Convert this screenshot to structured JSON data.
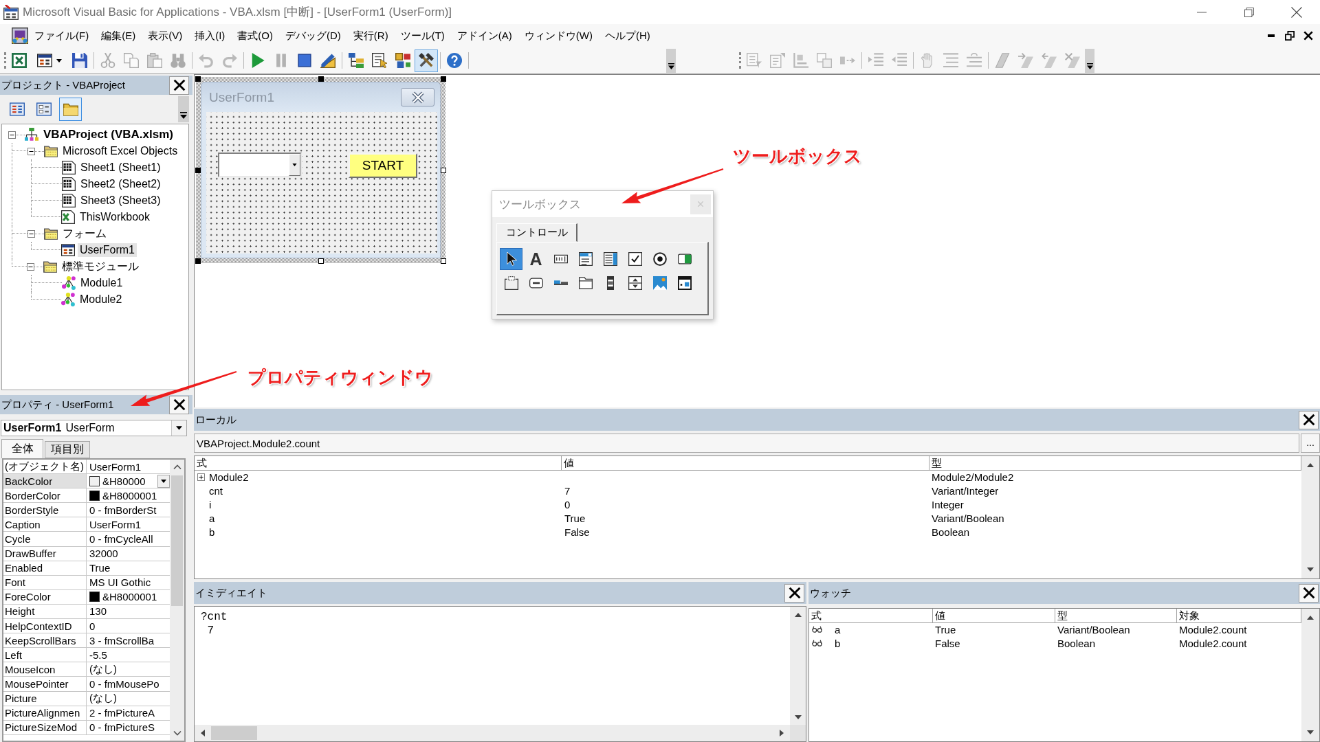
{
  "window": {
    "title": "Microsoft Visual Basic for Applications - VBA.xlsm [中断] - [UserForm1 (UserForm)]"
  },
  "menu": [
    "ファイル(F)",
    "編集(E)",
    "表示(V)",
    "挿入(I)",
    "書式(O)",
    "デバッグ(D)",
    "実行(R)",
    "ツール(T)",
    "アドイン(A)",
    "ウィンドウ(W)",
    "ヘルプ(H)"
  ],
  "toolbars": [
    {
      "kind": "standard",
      "items": [
        {
          "kind": "excel",
          "disabled": false,
          "pressed": false
        },
        {
          "kind": "insert-form",
          "disabled": false,
          "pressed": false
        },
        {
          "kind": "save",
          "disabled": false,
          "pressed": false
        },
        {
          "kind": "separator"
        },
        {
          "kind": "cut",
          "disabled": true,
          "pressed": false
        },
        {
          "kind": "copy",
          "disabled": true,
          "pressed": false
        },
        {
          "kind": "paste",
          "disabled": true,
          "pressed": false
        },
        {
          "kind": "find",
          "disabled": true,
          "pressed": false
        },
        {
          "kind": "separator"
        },
        {
          "kind": "undo",
          "disabled": true,
          "pressed": false
        },
        {
          "kind": "redo",
          "disabled": true,
          "pressed": false
        },
        {
          "kind": "separator"
        },
        {
          "kind": "run",
          "disabled": false,
          "pressed": false
        },
        {
          "kind": "break",
          "disabled": true,
          "pressed": false
        },
        {
          "kind": "reset",
          "disabled": false,
          "pressed": false
        },
        {
          "kind": "design-mode",
          "disabled": false,
          "pressed": false
        },
        {
          "kind": "separator"
        },
        {
          "kind": "project-explorer",
          "disabled": false,
          "pressed": false
        },
        {
          "kind": "properties",
          "disabled": false,
          "pressed": false
        },
        {
          "kind": "object-browser",
          "disabled": false,
          "pressed": false
        },
        {
          "kind": "toolbox",
          "disabled": false,
          "pressed": true
        },
        {
          "kind": "separator"
        },
        {
          "kind": "help",
          "disabled": false,
          "pressed": false
        },
        {
          "kind": "separator"
        }
      ]
    },
    {
      "kind": "edit",
      "items": [
        {
          "kind": "list-properties",
          "disabled": true,
          "pressed": false
        },
        {
          "kind": "list-constants",
          "disabled": true,
          "pressed": false
        },
        {
          "kind": "quick-info",
          "disabled": true,
          "pressed": false
        },
        {
          "kind": "parameter-info",
          "disabled": true,
          "pressed": false
        },
        {
          "kind": "complete-word",
          "disabled": true,
          "pressed": false
        },
        {
          "kind": "separator"
        },
        {
          "kind": "indent",
          "disabled": true,
          "pressed": false
        },
        {
          "kind": "outdent",
          "disabled": true,
          "pressed": false
        },
        {
          "kind": "separator"
        },
        {
          "kind": "toggle-breakpoint",
          "disabled": true,
          "pressed": false
        },
        {
          "kind": "comment-block",
          "disabled": true,
          "pressed": false
        },
        {
          "kind": "uncomment-block",
          "disabled": true,
          "pressed": false
        },
        {
          "kind": "separator"
        },
        {
          "kind": "toggle-bookmark",
          "disabled": true,
          "pressed": false
        },
        {
          "kind": "next-bookmark",
          "disabled": true,
          "pressed": false
        },
        {
          "kind": "previous-bookmark",
          "disabled": true,
          "pressed": false
        },
        {
          "kind": "clear-bookmarks",
          "disabled": true,
          "pressed": false
        }
      ]
    }
  ],
  "project": {
    "title": "プロジェクト - VBAProject",
    "buttons": [
      {
        "kind": "view-code",
        "pressed": false
      },
      {
        "kind": "view-object",
        "pressed": false
      },
      {
        "kind": "toggle-folders",
        "pressed": true
      }
    ],
    "tree": [
      {
        "label": "VBAProject (VBA.xlsm)",
        "kind": "project",
        "selected": false,
        "expanded": true,
        "children": [
          {
            "label": "Microsoft Excel Objects",
            "kind": "folder",
            "selected": false,
            "expanded": true,
            "children": [
              {
                "label": "Sheet1 (Sheet1)",
                "kind": "sheet",
                "selected": false
              },
              {
                "label": "Sheet2 (Sheet2)",
                "kind": "sheet",
                "selected": false
              },
              {
                "label": "Sheet3 (Sheet3)",
                "kind": "sheet",
                "selected": false
              },
              {
                "label": "ThisWorkbook",
                "kind": "workbook",
                "selected": false
              }
            ]
          },
          {
            "label": "フォーム",
            "kind": "folder",
            "selected": false,
            "expanded": true,
            "children": [
              {
                "label": "UserForm1",
                "kind": "form",
                "selected": true
              }
            ]
          },
          {
            "label": "標準モジュール",
            "kind": "folder",
            "selected": false,
            "expanded": true,
            "children": [
              {
                "label": "Module1",
                "kind": "module",
                "selected": false
              },
              {
                "label": "Module2",
                "kind": "module",
                "selected": false
              }
            ]
          }
        ]
      }
    ]
  },
  "properties": {
    "title": "プロパティ - UserForm1",
    "object": {
      "name": "UserForm1",
      "type": "UserForm"
    },
    "tabs": [
      {
        "label": "全体",
        "selected": true
      },
      {
        "label": "項目別",
        "selected": false
      }
    ],
    "rows": [
      {
        "name": "(オブジェクト名)",
        "value": "UserForm1",
        "selected": false
      },
      {
        "name": "BackColor",
        "value": "&H80000",
        "color": "#f0f0f0",
        "selected": true
      },
      {
        "name": "BorderColor",
        "value": "&H8000001",
        "color": "#000000",
        "selected": false
      },
      {
        "name": "BorderStyle",
        "value": "0 - fmBorderSt",
        "selected": false
      },
      {
        "name": "Caption",
        "value": "UserForm1",
        "selected": false
      },
      {
        "name": "Cycle",
        "value": "0 - fmCycleAll",
        "selected": false
      },
      {
        "name": "DrawBuffer",
        "value": "32000",
        "selected": false
      },
      {
        "name": "Enabled",
        "value": "True",
        "selected": false
      },
      {
        "name": "Font",
        "value": "MS UI Gothic",
        "selected": false
      },
      {
        "name": "ForeColor",
        "value": "&H8000001",
        "color": "#000000",
        "selected": false
      },
      {
        "name": "Height",
        "value": "130",
        "selected": false
      },
      {
        "name": "HelpContextID",
        "value": "0",
        "selected": false
      },
      {
        "name": "KeepScrollBars",
        "value": "3 - fmScrollBa",
        "selected": false
      },
      {
        "name": "Left",
        "value": "-5.5",
        "selected": false
      },
      {
        "name": "MouseIcon",
        "value": "(なし)",
        "selected": false
      },
      {
        "name": "MousePointer",
        "value": "0 - fmMousePo",
        "selected": false
      },
      {
        "name": "Picture",
        "value": "(なし)",
        "selected": false
      },
      {
        "name": "PictureAlignmen",
        "value": "2 - fmPictureA",
        "selected": false
      },
      {
        "name": "PictureSizeMod",
        "value": "0 - fmPictureS",
        "selected": false
      }
    ]
  },
  "designer": {
    "form": {
      "caption": "UserForm1",
      "controls": [
        {
          "kind": "combobox"
        },
        {
          "kind": "button",
          "label": "START"
        }
      ]
    }
  },
  "toolbox": {
    "title": "ツールボックス",
    "tabs": [
      {
        "label": "コントロール",
        "selected": true
      }
    ],
    "tools": [
      {
        "kind": "pointer",
        "selected": true
      },
      {
        "kind": "label",
        "glyph": "A",
        "selected": false
      },
      {
        "kind": "textbox",
        "selected": false
      },
      {
        "kind": "combobox",
        "selected": false
      },
      {
        "kind": "listbox",
        "selected": false
      },
      {
        "kind": "checkbox",
        "selected": false
      },
      {
        "kind": "optionbutton",
        "selected": false
      },
      {
        "kind": "togglebutton",
        "selected": false
      },
      {
        "kind": "frame",
        "selected": false
      },
      {
        "kind": "commandbutton",
        "selected": false
      },
      {
        "kind": "tabstrip",
        "selected": false
      },
      {
        "kind": "multipage",
        "selected": false
      },
      {
        "kind": "scrollbar",
        "selected": false
      },
      {
        "kind": "spinbutton",
        "selected": false
      },
      {
        "kind": "image",
        "selected": false
      },
      {
        "kind": "refedit",
        "selected": false
      }
    ]
  },
  "locals": {
    "title": "ローカル",
    "context": "VBAProject.Module2.count",
    "browse_button": "...",
    "columns": [
      "式",
      "値",
      "型"
    ],
    "rows": [
      {
        "kind": "object",
        "expanded": false,
        "expression": "Module2",
        "type": "Module2/Module2"
      },
      {
        "kind": "variable",
        "expression": "cnt",
        "value": "7",
        "type": "Variant/Integer"
      },
      {
        "kind": "variable",
        "expression": "i",
        "value": "0",
        "type": "Integer"
      },
      {
        "kind": "variable",
        "expression": "a",
        "value": "True",
        "type": "Variant/Boolean"
      },
      {
        "kind": "variable",
        "expression": "b",
        "value": "False",
        "type": "Boolean"
      }
    ]
  },
  "immediate": {
    "title": "イミディエイト",
    "lines": [
      "?cnt",
      " 7"
    ]
  },
  "watch": {
    "title": "ウォッチ",
    "columns": [
      "式",
      "値",
      "型",
      "対象"
    ],
    "rows": [
      {
        "expression": "a",
        "value": "True",
        "type": "Variant/Boolean",
        "context": "Module2.count"
      },
      {
        "expression": "b",
        "value": "False",
        "type": "Boolean",
        "context": "Module2.count"
      }
    ]
  },
  "annotations": [
    {
      "kind": "toolbox-callout",
      "text": "ツールボックス"
    },
    {
      "kind": "properties-callout",
      "text": "プロパティウィンドウ"
    }
  ]
}
